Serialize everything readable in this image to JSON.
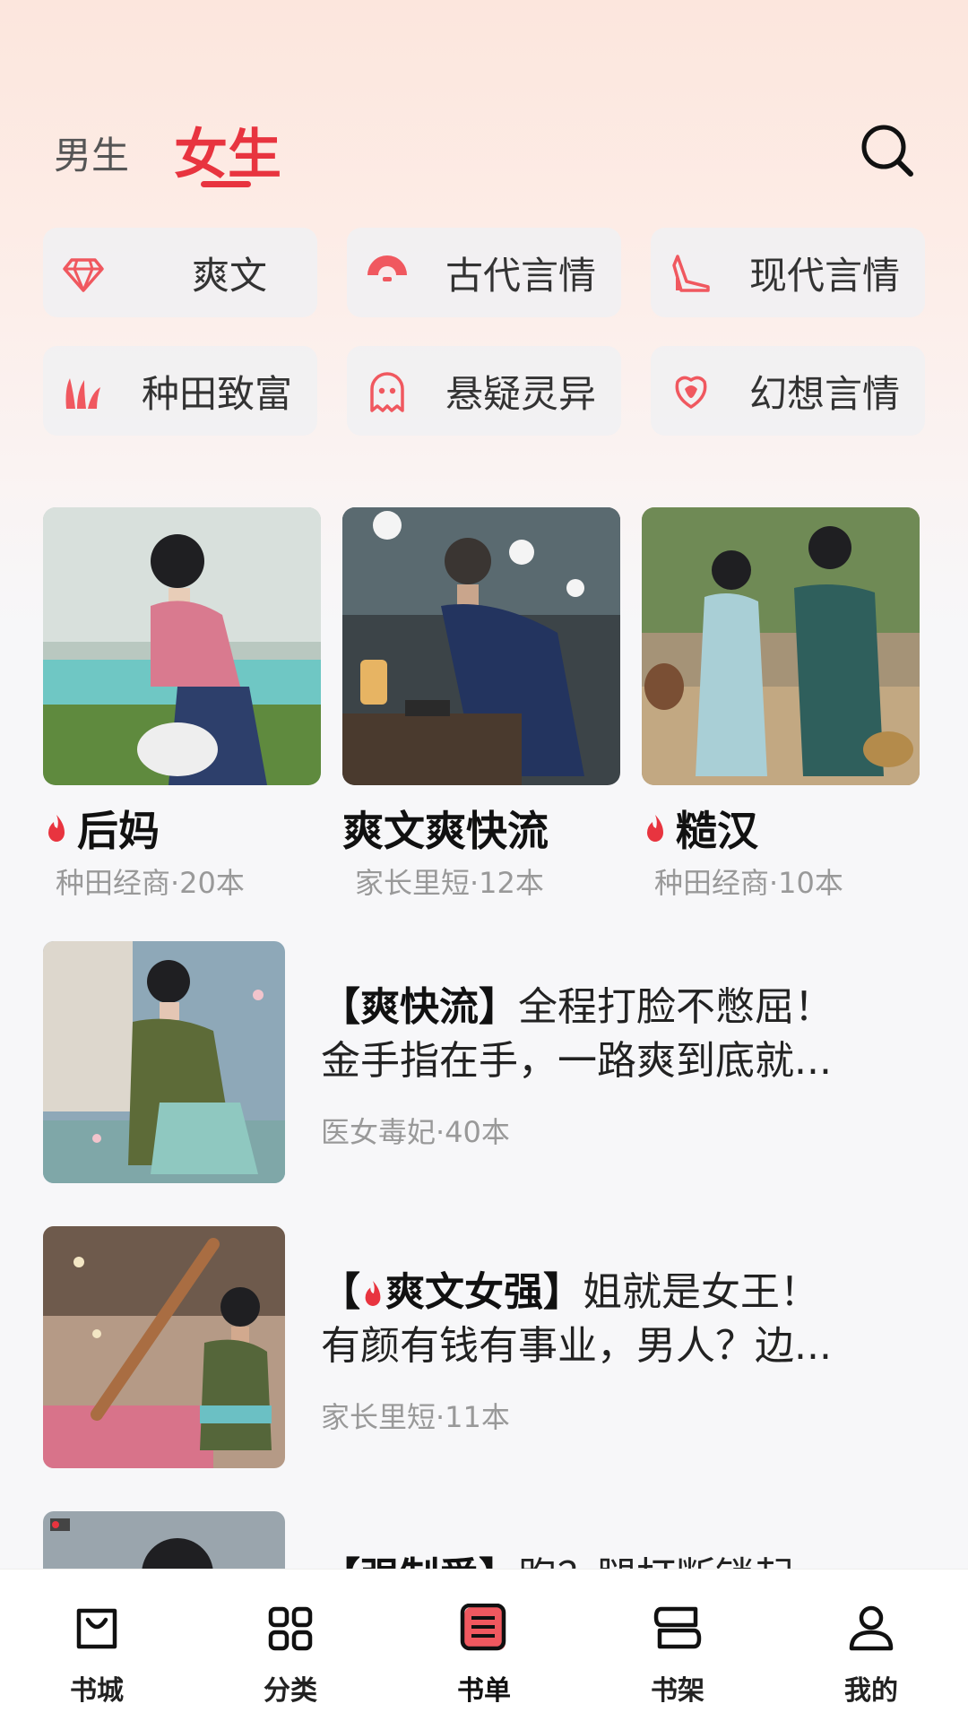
{
  "tabs": {
    "male": "男生",
    "female": "女生"
  },
  "icons": {
    "search": "search-icon"
  },
  "colors": {
    "accent": "#e8343f"
  },
  "categories": [
    {
      "label": "爽文",
      "icon": "diamond-icon"
    },
    {
      "label": "古代言情",
      "icon": "fan-icon"
    },
    {
      "label": "现代言情",
      "icon": "high-heel-icon"
    },
    {
      "label": "种田致富",
      "icon": "sprout-icon"
    },
    {
      "label": "悬疑灵异",
      "icon": "ghost-icon"
    },
    {
      "label": "幻想言情",
      "icon": "rose-icon"
    }
  ],
  "featured": [
    {
      "title": "后妈",
      "sub": "种田经商·20本",
      "hot": true
    },
    {
      "title": "爽文爽快流",
      "sub": "家长里短·12本",
      "hot": false
    },
    {
      "title": "糙汉",
      "sub": "种田经商·10本",
      "hot": true
    }
  ],
  "lists": [
    {
      "tag": "【爽快流】",
      "text1": "全程打脸不憋屈！",
      "text2": "金手指在手，一路爽到底就...",
      "sub": "医女毒妃·40本"
    },
    {
      "tag_pre": "【",
      "tag": "爽文女强】",
      "text1": "姐就是女王！",
      "text2": "有颜有钱有事业，男人？边...",
      "sub": "家长里短·11本"
    },
    {
      "tag": "【强制爱】",
      "text1": "跑？腿打断锁起",
      "sub": ""
    }
  ],
  "nav": [
    {
      "label": "书城",
      "icon": "bag-icon"
    },
    {
      "label": "分类",
      "icon": "grid-icon"
    },
    {
      "label": "书单",
      "icon": "list-icon",
      "active": true
    },
    {
      "label": "书架",
      "icon": "bookshelf-icon"
    },
    {
      "label": "我的",
      "icon": "person-icon"
    }
  ]
}
